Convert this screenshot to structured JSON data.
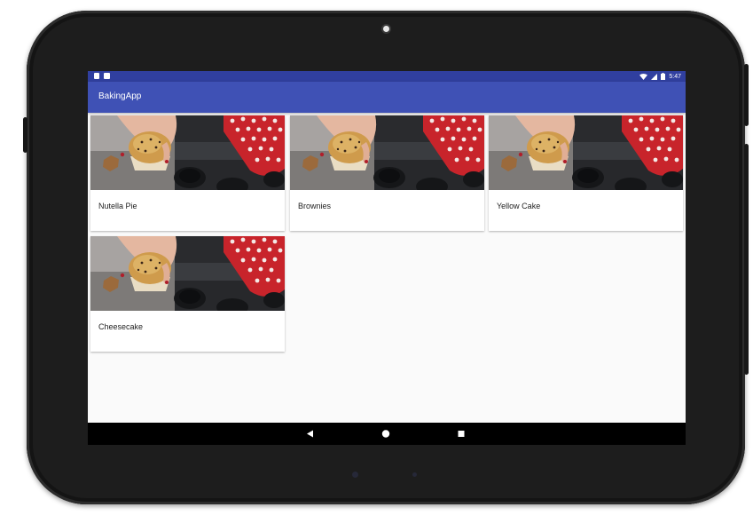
{
  "status_bar": {
    "time": "5:47",
    "left_icons": [
      "sd-card-icon",
      "notification-icon"
    ],
    "right_icons": [
      "wifi-icon",
      "cell-signal-icon",
      "battery-icon"
    ],
    "color": "#303f9f"
  },
  "app_bar": {
    "title": "BakingApp",
    "color": "#3f51b5"
  },
  "recipes": [
    {
      "name": "Nutella Pie",
      "image": "muffin-photo"
    },
    {
      "name": "Brownies",
      "image": "muffin-photo"
    },
    {
      "name": "Yellow Cake",
      "image": "muffin-photo"
    },
    {
      "name": "Cheesecake",
      "image": "muffin-photo"
    }
  ],
  "nav_bar": {
    "buttons": [
      "back-icon",
      "home-icon",
      "recents-icon"
    ]
  }
}
